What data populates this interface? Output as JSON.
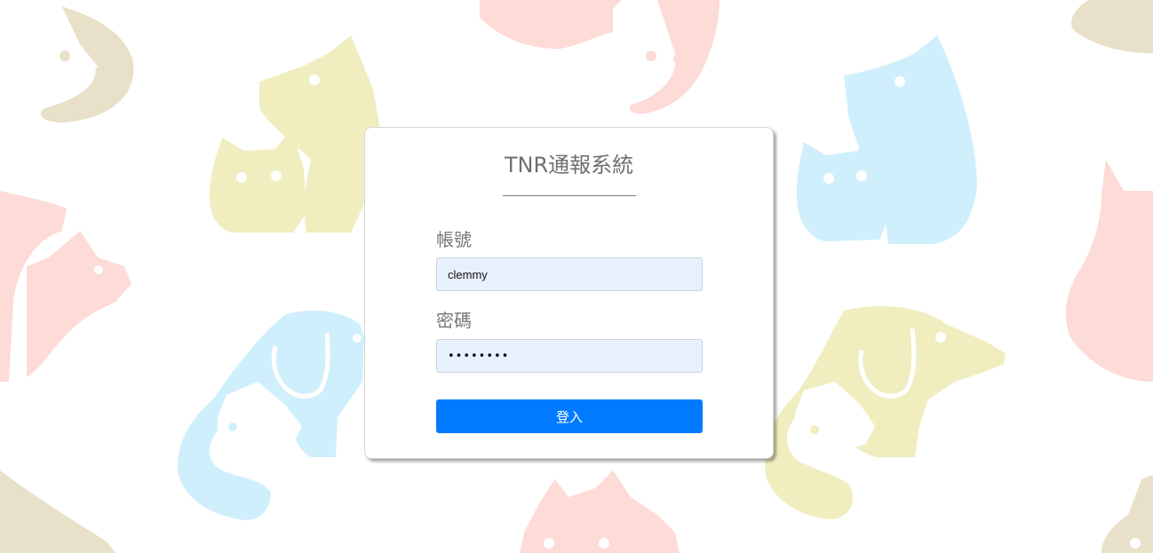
{
  "login": {
    "title": "TNR通報系統",
    "username_label": "帳號",
    "username_value": "clemmy",
    "password_label": "密碼",
    "password_value": "password",
    "submit_label": "登入"
  },
  "colors": {
    "button": "#007bff",
    "input_bg": "#e8f0fe",
    "pattern_pink": "#fddbd6",
    "pattern_yellow": "#f0edbf",
    "pattern_blue": "#d0effc",
    "pattern_tan": "#e8e0c8"
  },
  "background": {
    "pattern": "cats-and-dogs-silhouettes"
  }
}
